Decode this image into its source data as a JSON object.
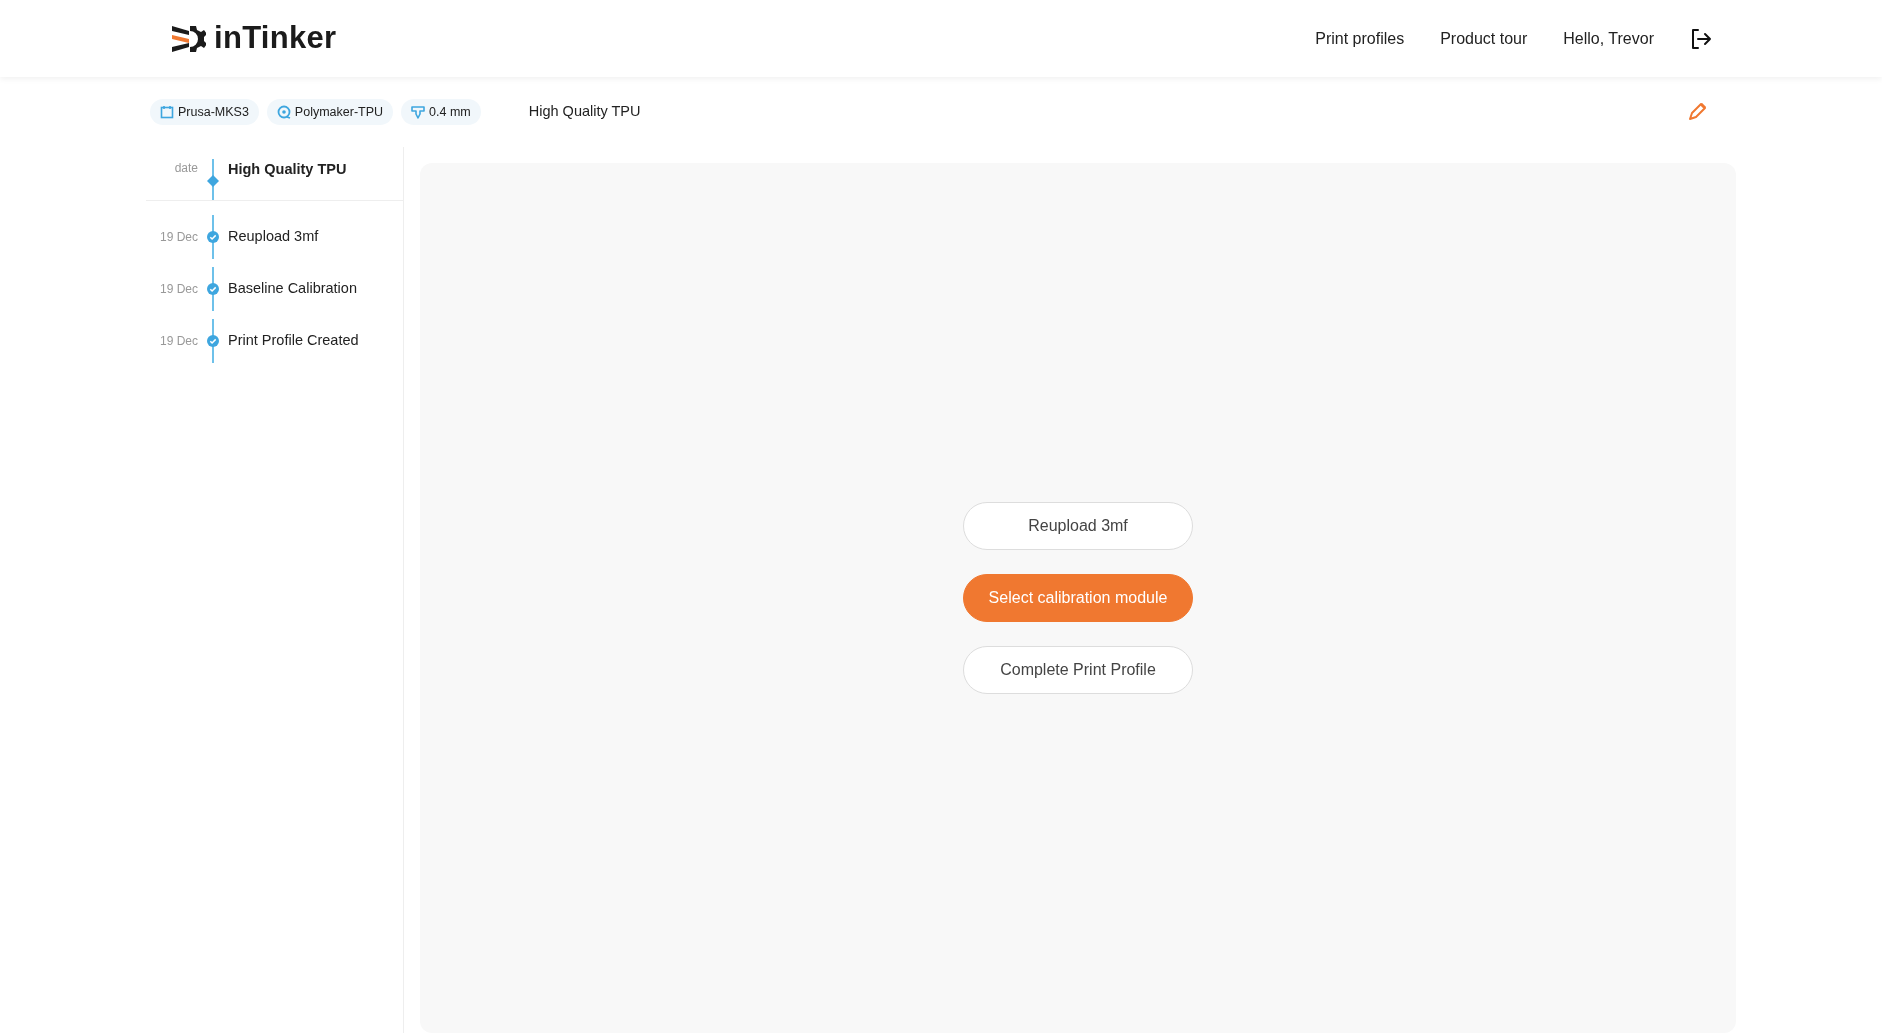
{
  "brand": {
    "name": "inTinker"
  },
  "nav": [
    {
      "label": "Print profiles"
    },
    {
      "label": "Product tour"
    },
    {
      "label": "Hello, Trevor"
    }
  ],
  "tags": [
    {
      "kind": "printer",
      "label": "Prusa-MKS3"
    },
    {
      "kind": "filament",
      "label": "Polymaker-TPU"
    },
    {
      "kind": "nozzle",
      "label": "0.4 mm"
    }
  ],
  "profile_title": "High Quality TPU",
  "timeline": {
    "header": {
      "date": "date",
      "title": "High Quality TPU"
    },
    "steps": [
      {
        "date": "19 Dec",
        "label": "Reupload 3mf",
        "done": true
      },
      {
        "date": "19 Dec",
        "label": "Baseline Calibration",
        "done": true
      },
      {
        "date": "19 Dec",
        "label": "Print Profile Created",
        "done": true
      }
    ]
  },
  "actions": [
    {
      "label": "Reupload 3mf",
      "kind": "outline"
    },
    {
      "label": "Select calibration module",
      "kind": "primary"
    },
    {
      "label": "Complete Print Profile",
      "kind": "outline"
    }
  ]
}
